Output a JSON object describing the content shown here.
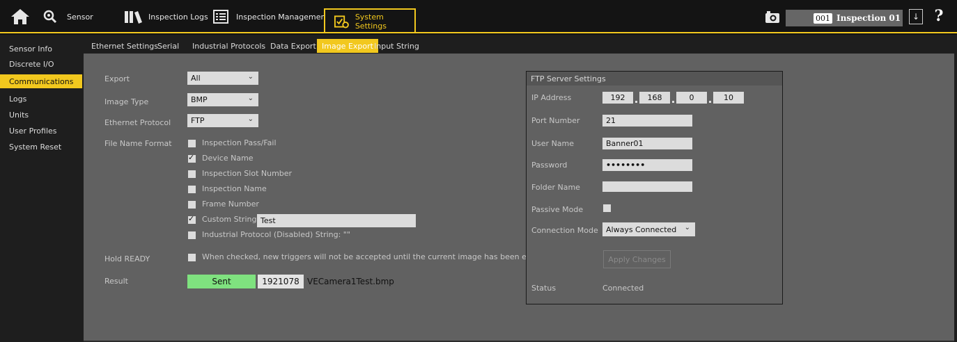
{
  "nav": {
    "sensor": "Sensor",
    "inspection_logs": "Inspection Logs",
    "inspection_management": "Inspection Management",
    "system_settings": "System Settings",
    "inspection_number": "001",
    "inspection_name": "Inspection 01",
    "down_arrow": "↓",
    "help": "?"
  },
  "sidebar": {
    "items": [
      {
        "label": "Sensor Info"
      },
      {
        "label": "Discrete I/O"
      },
      {
        "label": "Communications",
        "active": true
      },
      {
        "label": "Logs"
      },
      {
        "label": "Units"
      },
      {
        "label": "User Profiles"
      },
      {
        "label": "System Reset"
      }
    ]
  },
  "subtabs": {
    "items": [
      {
        "label": "Ethernet Settings"
      },
      {
        "label": "Serial"
      },
      {
        "label": "Industrial Protocols"
      },
      {
        "label": "Data Export"
      },
      {
        "label": "Image Export",
        "active": true
      },
      {
        "label": "Input String"
      }
    ]
  },
  "form": {
    "export_label": "Export",
    "export_value": "All",
    "image_type_label": "Image Type",
    "image_type_value": "BMP",
    "protocol_label": "Ethernet Protocol",
    "protocol_value": "FTP",
    "file_name_format_label": "File Name Format",
    "options": [
      {
        "label": "Inspection Pass/Fail",
        "checked": false
      },
      {
        "label": "Device Name",
        "checked": true
      },
      {
        "label": "Inspection Slot Number",
        "checked": false
      },
      {
        "label": "Inspection Name",
        "checked": false
      },
      {
        "label": "Frame Number",
        "checked": false
      },
      {
        "label": "Custom String",
        "checked": true
      },
      {
        "label": "Industrial Protocol (Disabled) String: \"\"",
        "checked": false
      }
    ],
    "custom_string_value": "Test",
    "hold_ready_label": "Hold READY",
    "hold_ready_text": "When checked, new triggers will not be accepted until the current image has been exported.",
    "hold_ready_checked": false,
    "result_label": "Result",
    "result_status": "Sent",
    "result_count": "1921078",
    "result_filename": "VECamera1Test.bmp"
  },
  "ftp": {
    "title": "FTP Server Settings",
    "ip_label": "IP Address",
    "ip": [
      "192",
      "168",
      "0",
      "10"
    ],
    "port_label": "Port Number",
    "port_value": "21",
    "user_label": "User Name",
    "user_value": "Banner01",
    "password_label": "Password",
    "password_value": "••••••••",
    "folder_label": "Folder Name",
    "folder_value": "",
    "passive_label": "Passive Mode",
    "passive_checked": false,
    "connection_label": "Connection Mode",
    "connection_value": "Always Connected",
    "apply_label": "Apply Changes",
    "status_label": "Status",
    "status_value": "Connected"
  },
  "colors": {
    "accent": "#f2c81e",
    "panel": "#616161",
    "sent": "#7fe27f"
  }
}
